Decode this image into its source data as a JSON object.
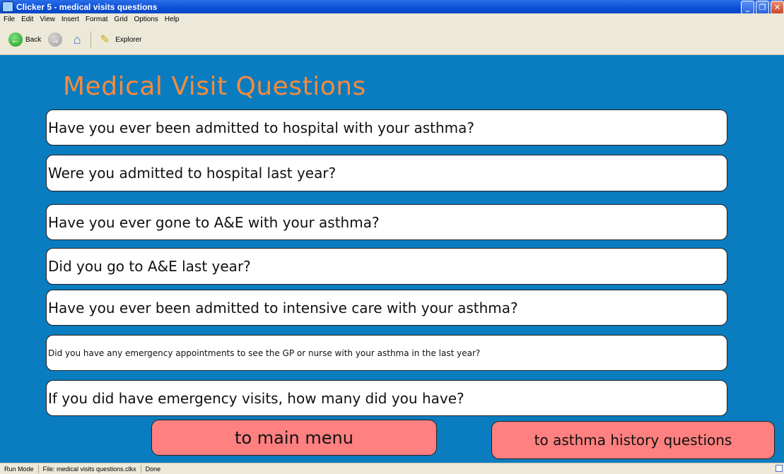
{
  "window": {
    "title": "Clicker 5 - medical visits questions",
    "buttons": {
      "minimize": "_",
      "maximize": "❐",
      "close": "✕"
    }
  },
  "menu": [
    "File",
    "Edit",
    "View",
    "Insert",
    "Format",
    "Grid",
    "Options",
    "Help"
  ],
  "toolbar": {
    "back_label": "Back",
    "explorer_label": "Explorer"
  },
  "page": {
    "title": "Medical Visit Questions",
    "questions": [
      "Have you ever been admitted to hospital with your asthma?",
      "Were you admitted to hospital last year?",
      "Have you ever gone to A&E with your asthma?",
      "Did you go to A&E last year?",
      "Have you ever been admitted to intensive care with your asthma?",
      "Did you have any emergency appointments to see the GP or nurse with your asthma in the last year?",
      "If you did have emergency visits, how many did you have?"
    ],
    "nav": {
      "main_menu": "to main menu",
      "asthma_history": "to asthma history questions"
    }
  },
  "status": {
    "mode": "Run Mode",
    "file": "File: medical visits questions.clkx",
    "state": "Done"
  },
  "colors": {
    "background": "#0a7cc0",
    "title": "#f58b3c",
    "card": "#ffffff",
    "nav_button": "#ff8080"
  }
}
